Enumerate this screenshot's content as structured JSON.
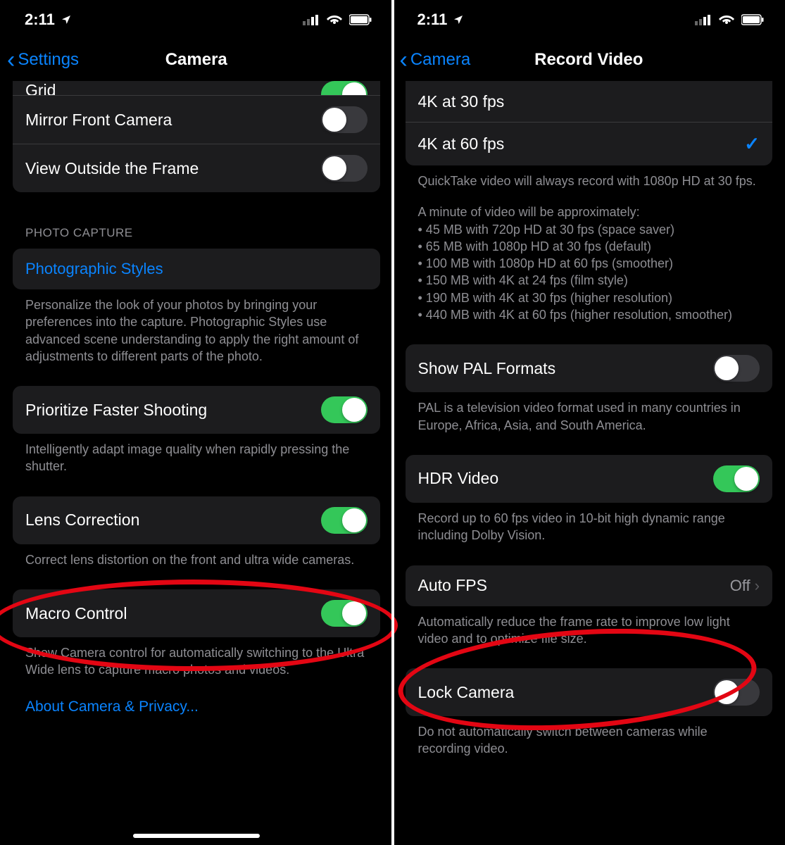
{
  "left": {
    "status": {
      "time": "2:11"
    },
    "nav": {
      "back": "Settings",
      "title": "Camera"
    },
    "group1": {
      "grid": {
        "label": "Grid",
        "on": true
      },
      "mirror": {
        "label": "Mirror Front Camera",
        "on": false
      },
      "viewoutside": {
        "label": "View Outside the Frame",
        "on": false
      }
    },
    "section_photo_capture": "PHOTO CAPTURE",
    "photographic_styles": {
      "label": "Photographic Styles"
    },
    "footnote_styles": "Personalize the look of your photos by bringing your preferences into the capture. Photographic Styles use advanced scene understanding to apply the right amount of adjustments to different parts of the photo.",
    "prioritize": {
      "label": "Prioritize Faster Shooting",
      "on": true
    },
    "footnote_prioritize": "Intelligently adapt image quality when rapidly pressing the shutter.",
    "lens": {
      "label": "Lens Correction",
      "on": true
    },
    "footnote_lens": "Correct lens distortion on the front and ultra wide cameras.",
    "macro": {
      "label": "Macro Control",
      "on": true
    },
    "footnote_macro": "Show Camera control for automatically switching to the Ultra Wide lens to capture macro photos and videos.",
    "about": "About Camera & Privacy..."
  },
  "right": {
    "status": {
      "time": "2:11"
    },
    "nav": {
      "back": "Camera",
      "title": "Record Video"
    },
    "res": {
      "r1": "4K at 30 fps",
      "r2": "4K at 60 fps"
    },
    "footnote_quicktake": "QuickTake video will always record with 1080p HD at 30 fps.",
    "footnote_sizes_intro": "A minute of video will be approximately:",
    "footnote_sizes": [
      "• 45 MB with 720p HD at 30 fps (space saver)",
      "• 65 MB with 1080p HD at 30 fps (default)",
      "• 100 MB with 1080p HD at 60 fps (smoother)",
      "• 150 MB with 4K at 24 fps (film style)",
      "• 190 MB with 4K at 30 fps (higher resolution)",
      "• 440 MB with 4K at 60 fps (higher resolution, smoother)"
    ],
    "pal": {
      "label": "Show PAL Formats",
      "on": false
    },
    "footnote_pal": "PAL is a television video format used in many countries in Europe, Africa, Asia, and South America.",
    "hdr": {
      "label": "HDR Video",
      "on": true
    },
    "footnote_hdr": "Record up to 60 fps video in 10-bit high dynamic range including Dolby Vision.",
    "autofps": {
      "label": "Auto FPS",
      "value": "Off"
    },
    "footnote_autofps": "Automatically reduce the frame rate to improve low light video and to optimize file size.",
    "lock": {
      "label": "Lock Camera",
      "on": false
    },
    "footnote_lock": "Do not automatically switch between cameras while recording video."
  }
}
